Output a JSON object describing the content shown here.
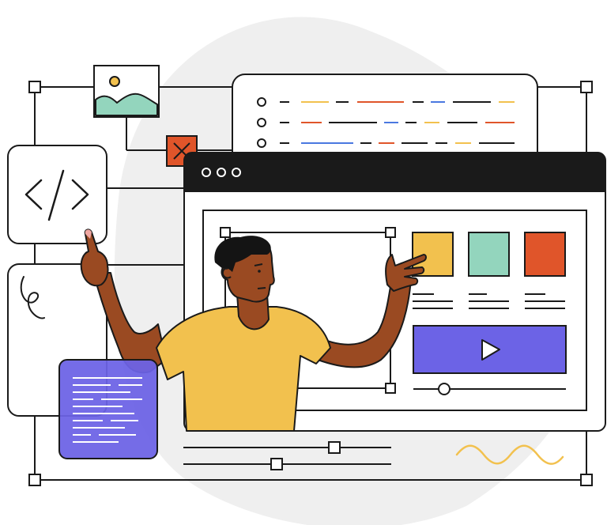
{
  "illustration": {
    "colors": {
      "outline": "#1a1a1a",
      "blob": "#efefef",
      "yellow": "#f2c14e",
      "mint": "#93d5bd",
      "orange": "#e0552a",
      "purple": "#6c63e6",
      "blue": "#4a78e0",
      "skin": "#9a4a22",
      "hair": "#141414",
      "nail": "#f0a7a2"
    },
    "icons": [
      "image-icon",
      "close-icon",
      "code-icon",
      "play-icon",
      "squiggle-icon",
      "wave-icon"
    ],
    "browser_dots": 3,
    "swatches": [
      "yellow",
      "mint",
      "orange"
    ],
    "list_rows": 3
  }
}
